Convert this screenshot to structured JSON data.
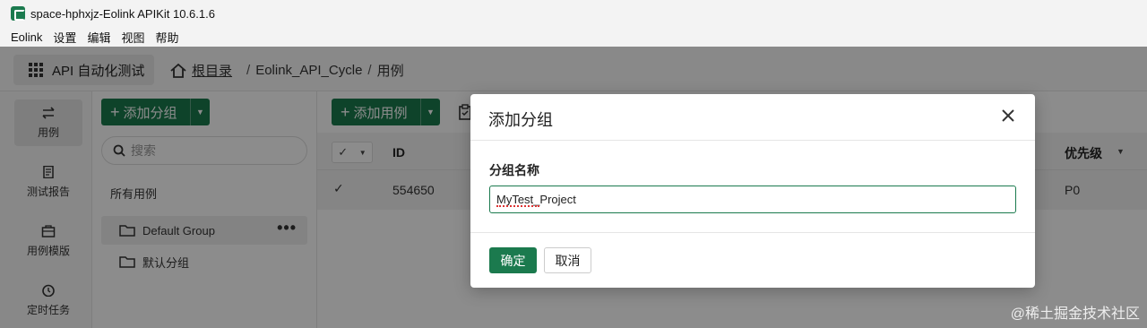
{
  "window": {
    "title": "space-hphxjz-Eolink APIKit 10.6.1.6"
  },
  "menu": {
    "items": [
      "Eolink",
      "设置",
      "编辑",
      "视图",
      "帮助"
    ]
  },
  "toolbar": {
    "module_label": "API 自动化测试",
    "breadcrumb": {
      "root": "根目录",
      "project": "Eolink_API_Cycle",
      "current": "用例",
      "separator": "/"
    }
  },
  "sidebar": {
    "items": [
      {
        "label": "用例",
        "icon": "swap-arrows-icon",
        "active": true
      },
      {
        "label": "测试报告",
        "icon": "report-icon"
      },
      {
        "label": "用例模版",
        "icon": "template-icon"
      },
      {
        "label": "定时任务",
        "icon": "clock-icon"
      }
    ]
  },
  "groups": {
    "add_label": "添加分组",
    "search_placeholder": "搜索",
    "all_label": "所有用例",
    "items": [
      {
        "name": "Default Group",
        "active": true
      },
      {
        "name": "默认分组"
      }
    ],
    "more": "•••"
  },
  "main": {
    "add_case_label": "添加用例",
    "columns": {
      "id": "ID",
      "priority": "优先级"
    },
    "rows": [
      {
        "check": "✓",
        "id": "554650",
        "priority": "P0"
      }
    ]
  },
  "dialog": {
    "title": "添加分组",
    "field_label": "分组名称",
    "field_value": "MyTest_Project",
    "ok_label": "确定",
    "cancel_label": "取消"
  },
  "watermark": "@稀土掘金技术社区",
  "colors": {
    "accent": "#1b7a4e"
  }
}
